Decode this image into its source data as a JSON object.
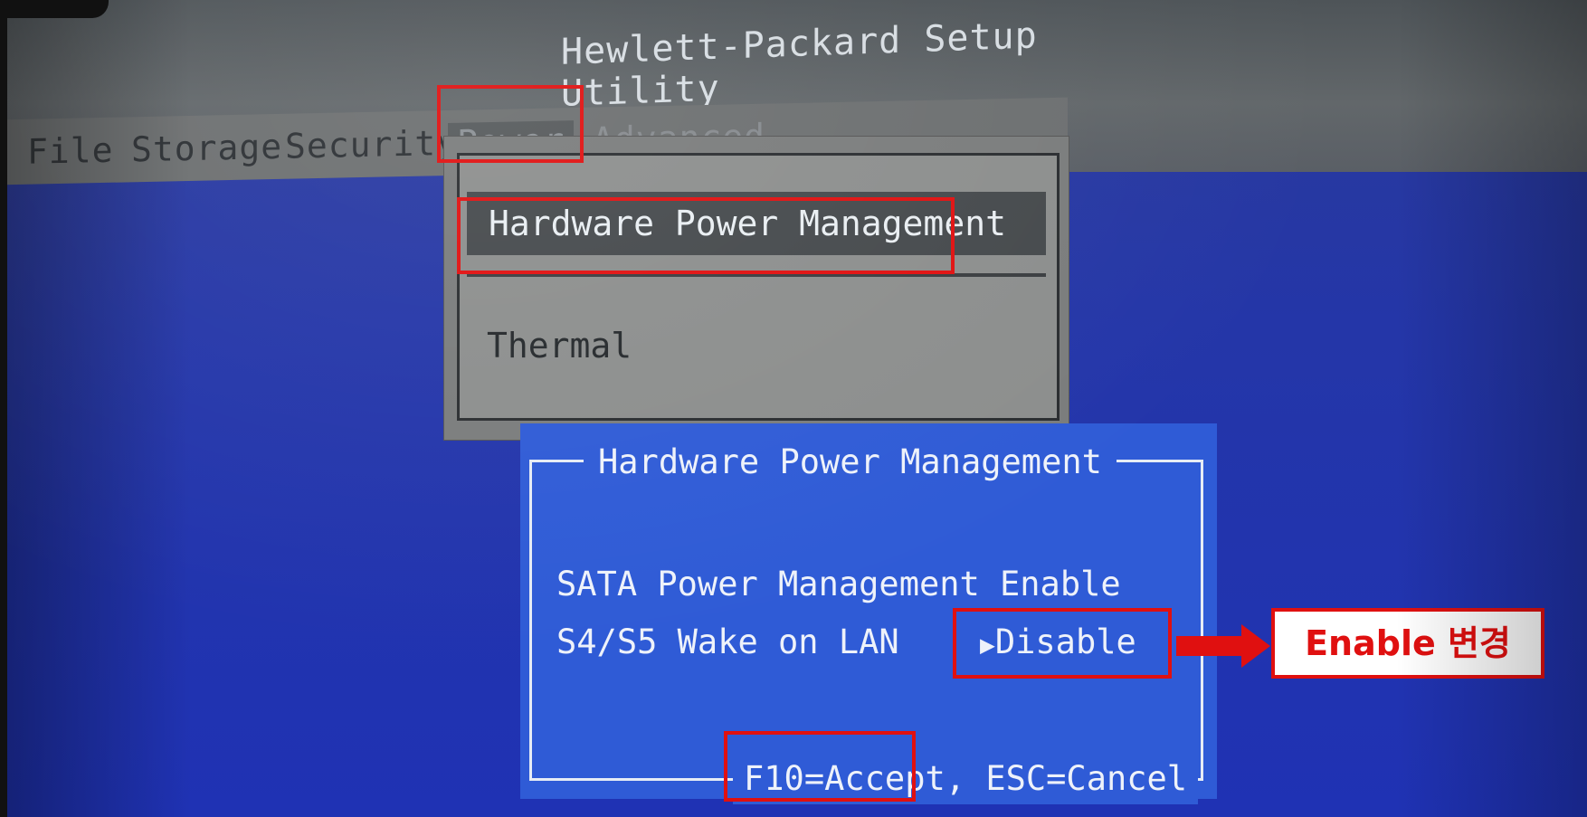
{
  "window": {
    "title": "Hewlett-Packard Setup Utility"
  },
  "menubar": {
    "items": [
      {
        "label": "File"
      },
      {
        "label": "Storage"
      },
      {
        "label": "Security"
      },
      {
        "label": "Power"
      },
      {
        "label": "Advanced"
      }
    ]
  },
  "power_menu": {
    "items": [
      {
        "label": "Hardware Power Management"
      },
      {
        "label": "Thermal"
      }
    ]
  },
  "dialog": {
    "title": "Hardware Power Management",
    "settings": [
      {
        "label": "SATA Power Management",
        "value": "Enable"
      },
      {
        "label": "S4/S5 Wake on LAN",
        "value": "Disable",
        "pointer": "▶"
      }
    ],
    "footer": {
      "accept": "F10=Accept,",
      "cancel": "ESC=Cancel"
    }
  },
  "annotation": {
    "callout_text": "Enable 변경",
    "color": "#e01010"
  },
  "colors": {
    "bios_blue": "#2f5bd6",
    "menu_gray": "#6c6f70"
  }
}
